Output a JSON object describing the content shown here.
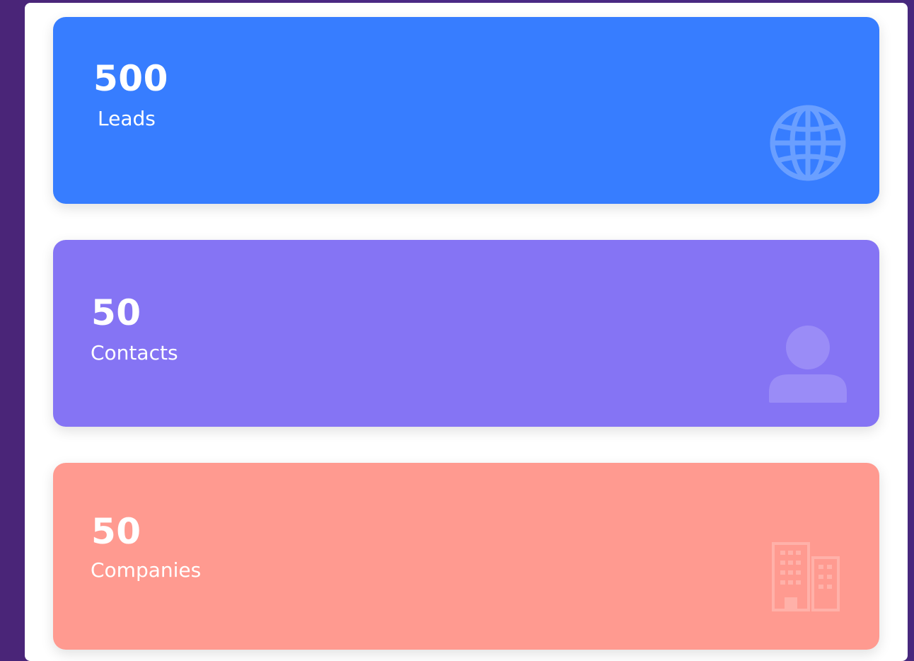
{
  "cards": {
    "leads": {
      "count": "500",
      "label": "Leads",
      "color": "#377dff",
      "icon": "globe-icon"
    },
    "contacts": {
      "count": "50",
      "label": "Contacts",
      "color": "#8574f4",
      "icon": "user-icon"
    },
    "companies": {
      "count": "50",
      "label": "Companies",
      "color": "#ff9a90",
      "icon": "building-icon"
    }
  }
}
